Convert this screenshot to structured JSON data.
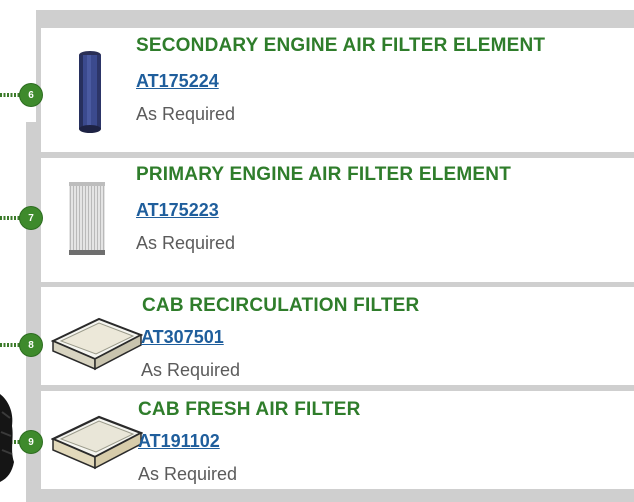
{
  "filters": [
    {
      "callout": "6",
      "title": "SECONDARY ENGINE AIR FILTER ELEMENT",
      "part": "AT175224",
      "interval": "As Required",
      "icon": "secondary-air-filter-icon"
    },
    {
      "callout": "7",
      "title": "PRIMARY ENGINE AIR FILTER ELEMENT",
      "part": "AT175223",
      "interval": "As Required",
      "icon": "primary-air-filter-icon"
    },
    {
      "callout": "8",
      "title": "CAB RECIRCULATION FILTER",
      "part": "AT307501",
      "interval": "As Required",
      "icon": "cab-recirculation-filter-icon"
    },
    {
      "callout": "9",
      "title": "CAB FRESH AIR FILTER",
      "part": "AT191102",
      "interval": "As Required",
      "icon": "cab-fresh-air-filter-icon"
    }
  ],
  "colors": {
    "title": "#2f7d2b",
    "link": "#1f5e9c",
    "callout": "#3e8a2c",
    "frame": "#cfcfcf"
  }
}
